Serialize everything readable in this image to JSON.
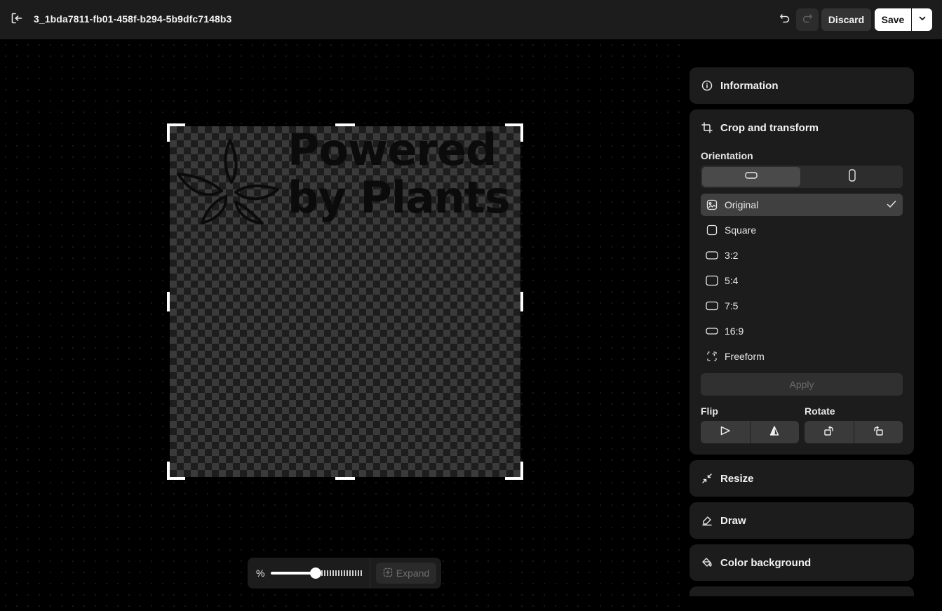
{
  "header": {
    "file_name": "3_1bda7811-fb01-458f-b294-5b9dfc7148b3",
    "discard_label": "Discard",
    "save_label": "Save"
  },
  "canvas": {
    "logo_text_line1": "Powered",
    "logo_text_line2": "by Plants"
  },
  "zoom": {
    "unit_label": "%",
    "level_fraction": 0.49,
    "expand_label": "Expand"
  },
  "sidebar": {
    "information": {
      "title": "Information",
      "icon": "info-icon"
    },
    "crop": {
      "title": "Crop and transform",
      "icon": "crop-icon",
      "orientation_label": "Orientation",
      "orientation_selected": "landscape",
      "ratios": [
        {
          "label": "Original",
          "icon": "image-icon",
          "selected": true
        },
        {
          "label": "Square",
          "icon": "square-icon",
          "selected": false
        },
        {
          "label": "3:2",
          "icon": "ratio-rect-icon",
          "selected": false
        },
        {
          "label": "5:4",
          "icon": "ratio-rect-icon",
          "selected": false
        },
        {
          "label": "7:5",
          "icon": "ratio-rect-icon",
          "selected": false
        },
        {
          "label": "16:9",
          "icon": "ratio-rect-icon",
          "selected": false
        },
        {
          "label": "Freeform",
          "icon": "freeform-icon",
          "selected": false
        }
      ],
      "apply_label": "Apply",
      "flip_label": "Flip",
      "rotate_label": "Rotate"
    },
    "resize": {
      "title": "Resize",
      "icon": "resize-icon"
    },
    "draw": {
      "title": "Draw",
      "icon": "pen-icon"
    },
    "color_background": {
      "title": "Color background",
      "icon": "paint-bucket-icon"
    }
  },
  "colors": {
    "topbar_bg": "#1c1c1c",
    "panel_bg": "#1c1c1c",
    "selected_item_bg": "#404040",
    "save_bg": "#ffffff"
  }
}
